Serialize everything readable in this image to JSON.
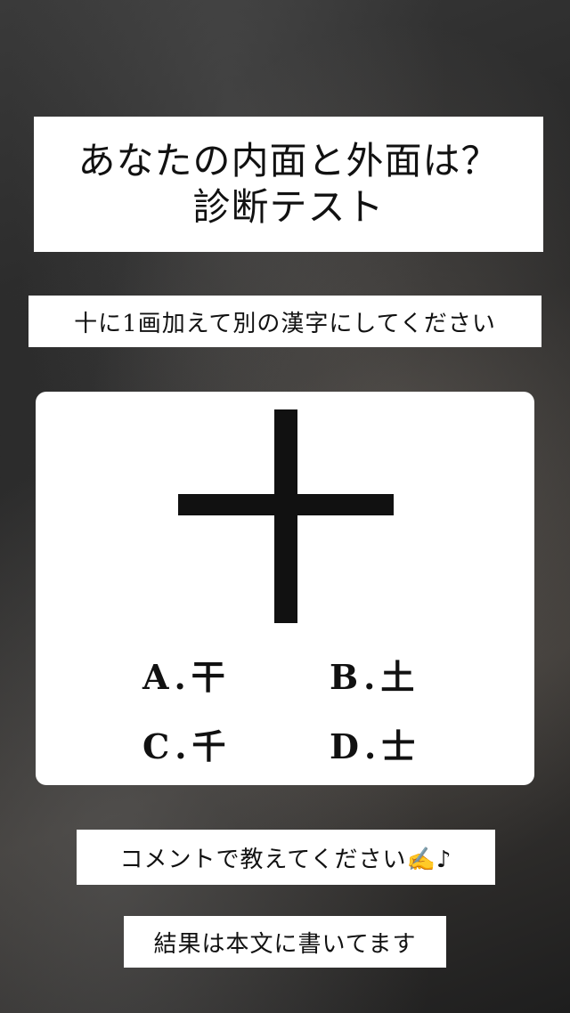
{
  "title": {
    "line1": "あなたの内面と外面は？",
    "line2": "診断テスト"
  },
  "instruction": "十に1画加えて別の漢字にしてください",
  "puzzle": {
    "base_character": "十",
    "options": [
      {
        "letter": "A",
        "dot": ".",
        "kanji": "干"
      },
      {
        "letter": "B",
        "dot": ".",
        "kanji": "土"
      },
      {
        "letter": "C",
        "dot": ".",
        "kanji": "千"
      },
      {
        "letter": "D",
        "dot": ".",
        "kanji": "士"
      }
    ]
  },
  "comment_prompt": "コメントで教えてください✍️♪",
  "result_note": "結果は本文に書いてます",
  "colors": {
    "card_background": "#ffffff",
    "text": "#111111"
  }
}
